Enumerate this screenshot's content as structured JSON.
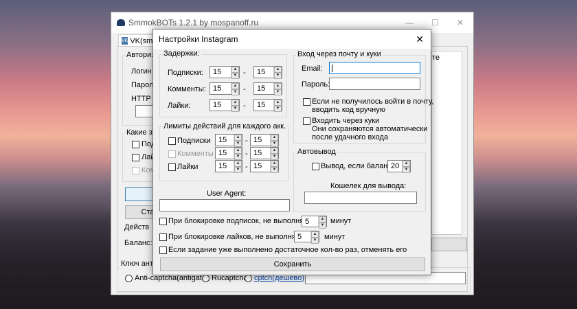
{
  "main": {
    "title": "SmmokBOTs 1.2.1 by mospanoff.ru",
    "tab": "VK(smm",
    "auth_group": "Авториза",
    "login_label": "Логин:",
    "password_label": "Пароль:",
    "http_label": "HTTP pro",
    "tasks_group": "Какие зад",
    "task1": "Подп",
    "task2": "Лайк",
    "task3": "Комм",
    "start_btn": "Ста",
    "actions_label": "Действ",
    "balance_label": "Баланс:  0",
    "right_fragment": "те",
    "captcha_label": "Ключ антик",
    "captcha_opt1": "Anti-captcha(antigate)",
    "captcha_opt2": "Rucaptcha",
    "captcha_opt3": "cptch(дешево)"
  },
  "dialog": {
    "title": "Настройки Instagram",
    "delays": {
      "title": "Задержки:",
      "rows": [
        {
          "label": "Подписки:",
          "from": "15",
          "to": "15"
        },
        {
          "label": "Комменты:",
          "from": "15",
          "to": "15"
        },
        {
          "label": "Лайки:",
          "from": "15",
          "to": "15"
        }
      ],
      "dash": "-"
    },
    "limits": {
      "title": "Лимиты действий для каждого акк.",
      "rows": [
        {
          "label": "Подписки",
          "from": "15",
          "to": "15",
          "disabled": false
        },
        {
          "label": "Комменты",
          "from": "15",
          "to": "15",
          "disabled": true
        },
        {
          "label": "Лайки",
          "from": "15",
          "to": "15",
          "disabled": false
        }
      ],
      "dash": "-"
    },
    "user_agent_label": "User Agent:",
    "login": {
      "title": "Вход через почту и куки",
      "email_label": "Email:",
      "password_label": "Пароль:",
      "code_manual_line1": "Если не получилось войти в почту,",
      "code_manual_line2": "вводить код вручную",
      "cookies_line1": "Входить через куки",
      "cookies_line2": "Они сохраняются автоматически",
      "cookies_line3": "после удачного входа"
    },
    "autowithdraw": {
      "title": "Автовывод",
      "balance_label": "Вывод, если баланс>",
      "balance_value": "20",
      "wallet_label": "Кошелек для вывода:"
    },
    "block_follow_label": "При блокировке подписок, не выполнять их",
    "block_follow_value": "5",
    "block_follow_unit": "минут",
    "block_like_label": "При блокировке лайков, не выполнять их",
    "block_like_value": "5",
    "block_like_unit": "минут",
    "skip_done_label": "Если задание уже выполнено достаточное кол-во раз, отменять его",
    "save_btn": "Сохранить",
    "close_glyph": "✕"
  }
}
